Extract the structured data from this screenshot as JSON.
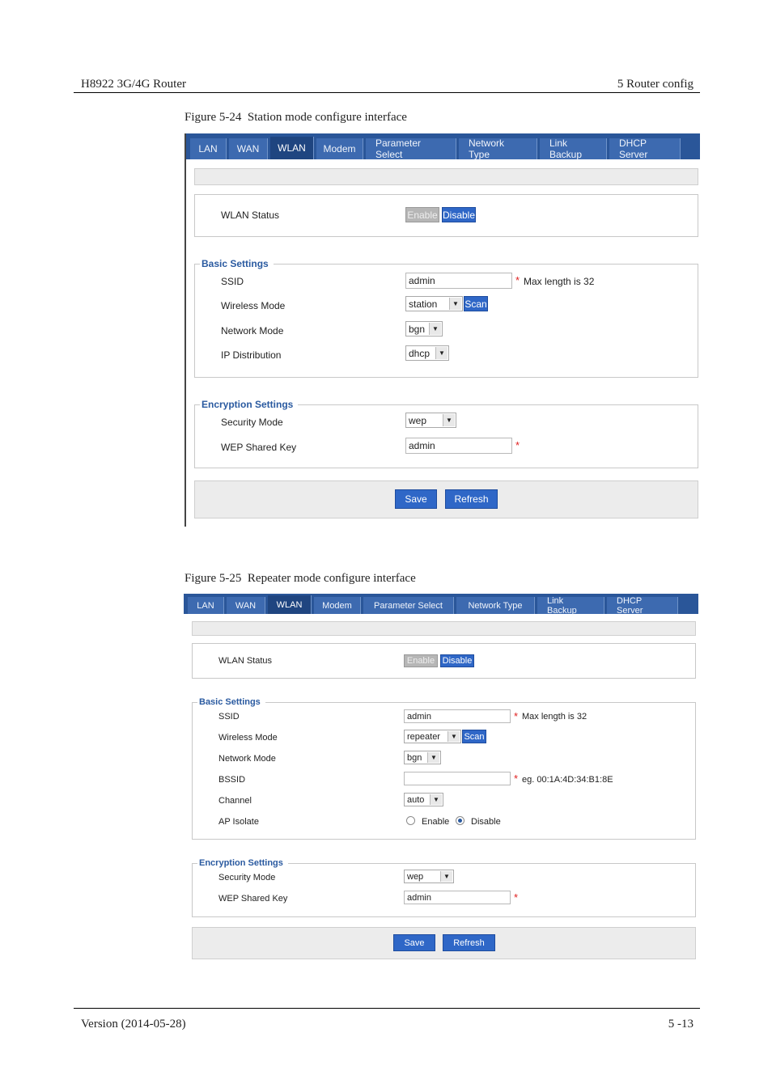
{
  "page_header": {
    "left": "H8922 3G/4G Router",
    "right": "5 Router config"
  },
  "page_footer": {
    "left": "Version (2014-05-28)",
    "right": "5 -13"
  },
  "figure1": {
    "caption_num": "Figure 5-24",
    "caption_text": "Station mode configure interface",
    "tabs": [
      "LAN",
      "WAN",
      "WLAN",
      "Modem",
      "Parameter Select",
      "Network Type",
      "Link Backup",
      "DHCP Server"
    ],
    "active_tab": "WLAN",
    "wlan_status": {
      "label": "WLAN Status",
      "enable": "Enable",
      "disable": "Disable"
    },
    "basic": {
      "legend": "Basic Settings",
      "ssid_label": "SSID",
      "ssid_value": "admin",
      "ssid_hint": "Max length is 32",
      "wireless_mode_label": "Wireless Mode",
      "wireless_mode_value": "station",
      "scan": "Scan",
      "network_mode_label": "Network Mode",
      "network_mode_value": "bgn",
      "ip_dist_label": "IP Distribution",
      "ip_dist_value": "dhcp"
    },
    "encryption": {
      "legend": "Encryption Settings",
      "security_mode_label": "Security Mode",
      "security_mode_value": "wep",
      "wep_key_label": "WEP Shared Key",
      "wep_key_value": "admin"
    },
    "buttons": {
      "save": "Save",
      "refresh": "Refresh"
    },
    "required_mark": "*"
  },
  "figure2": {
    "caption_num": "Figure 5-25",
    "caption_text": "Repeater mode configure interface",
    "tabs": [
      "LAN",
      "WAN",
      "WLAN",
      "Modem",
      "Parameter Select",
      "Network Type",
      "Link Backup",
      "DHCP Server"
    ],
    "active_tab": "WLAN",
    "wlan_status": {
      "label": "WLAN Status",
      "enable": "Enable",
      "disable": "Disable"
    },
    "basic": {
      "legend": "Basic Settings",
      "ssid_label": "SSID",
      "ssid_value": "admin",
      "ssid_hint": "Max length is 32",
      "wireless_mode_label": "Wireless Mode",
      "wireless_mode_value": "repeater",
      "scan": "Scan",
      "network_mode_label": "Network Mode",
      "network_mode_value": "bgn",
      "bssid_label": "BSSID",
      "bssid_value": "",
      "bssid_hint": "eg. 00:1A:4D:34:B1:8E",
      "channel_label": "Channel",
      "channel_value": "auto",
      "ap_isolate_label": "AP Isolate",
      "ap_isolate_enable": "Enable",
      "ap_isolate_disable": "Disable",
      "ap_isolate_selected": "Disable"
    },
    "encryption": {
      "legend": "Encryption Settings",
      "security_mode_label": "Security Mode",
      "security_mode_value": "wep",
      "wep_key_label": "WEP Shared Key",
      "wep_key_value": "admin"
    },
    "buttons": {
      "save": "Save",
      "refresh": "Refresh"
    },
    "required_mark": "*"
  }
}
